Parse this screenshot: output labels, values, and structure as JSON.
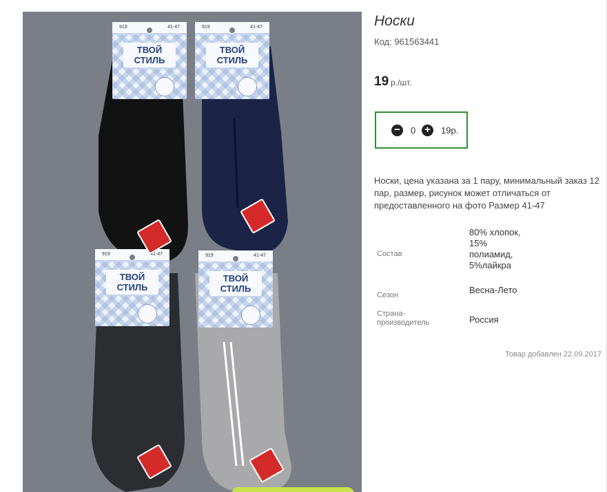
{
  "product": {
    "title": "Носки",
    "code": "Код: 961563441",
    "price_value": "19",
    "price_unit": "р./шт.",
    "quantity": {
      "minus_symbol": "−",
      "plus_symbol": "+",
      "value": "0",
      "total": "19р."
    },
    "description": "Носки, цена указана за 1 пару, минимальный заказ 12 пар, размер, рисунок может отличаться от предоставленного на фото Размер 41-47",
    "properties": [
      {
        "label": "Состав",
        "value": "80% хлопок, 15% полиамид, 5%лайкра"
      },
      {
        "label": "Сезон",
        "value": "Весна-Лето"
      },
      {
        "label": "Страна-производитель",
        "value": "Россия"
      }
    ],
    "added": "Товар добавлен 22.09.2017"
  },
  "photo": {
    "cards": [
      {
        "num": "919",
        "size": "41-47",
        "brand": "ТВОЙ СТИЛЬ"
      },
      {
        "num": "919",
        "size": "41-47",
        "brand": "ТВОЙ СТИЛЬ"
      },
      {
        "num": "919",
        "size": "41-47",
        "brand": "ТВОЙ СТИЛЬ"
      },
      {
        "num": "919",
        "size": "41-47",
        "brand": "ТВОЙ СТИЛЬ"
      }
    ]
  },
  "colors": {
    "accent_border": "#2f8f33",
    "photo_bg": "#7a7f87",
    "sock_black": "#121212",
    "sock_navy": "#1b2447",
    "sock_darkgray": "#2b2d31",
    "sock_lightgray": "#a9a9ab"
  }
}
